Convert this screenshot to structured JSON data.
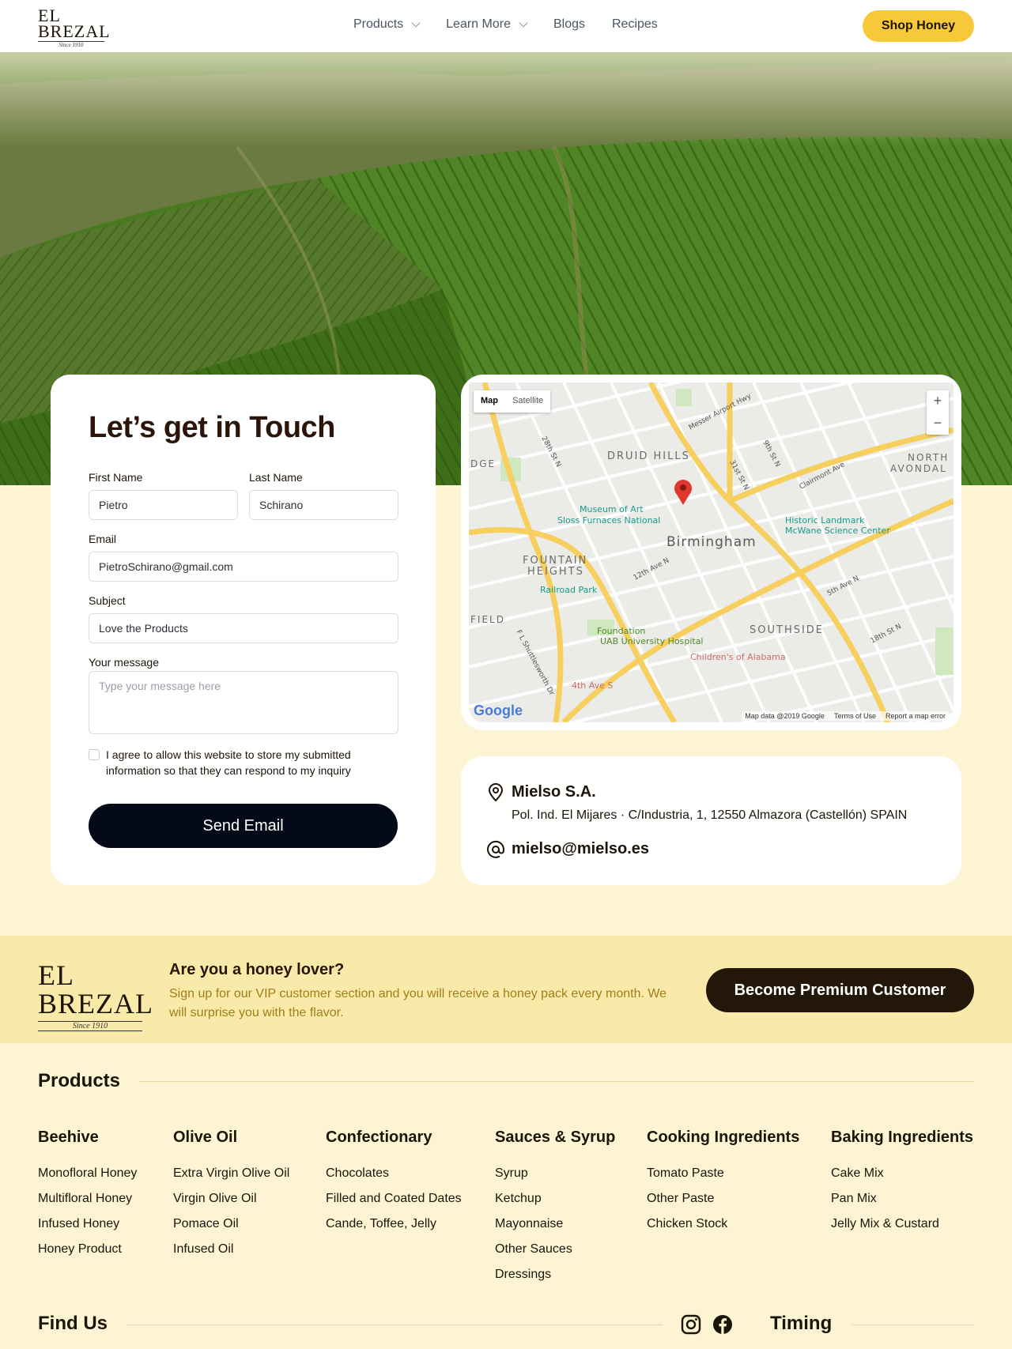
{
  "brand": {
    "logo_top": "EL BREZAL",
    "logo_since": "Since 1910"
  },
  "nav": {
    "items": [
      {
        "label": "Products",
        "dropdown": true
      },
      {
        "label": "Learn More",
        "dropdown": true
      },
      {
        "label": "Blogs",
        "dropdown": false
      },
      {
        "label": "Recipes",
        "dropdown": false
      }
    ],
    "cta": "Shop Honey"
  },
  "contact": {
    "title": "Let’s get in Touch",
    "first_name_label": "First Name",
    "first_name_value": "Pietro",
    "last_name_label": "Last Name",
    "last_name_value": "Schirano",
    "email_label": "Email",
    "email_value": "PietroSchirano@gmail.com",
    "subject_label": "Subject",
    "subject_value": "Love the Products",
    "message_label": "Your message",
    "message_placeholder": "Type your message here",
    "consent": "I agree to allow this website to store my submitted information so that they can respond to my inquiry",
    "submit": "Send Email"
  },
  "map": {
    "toggle": [
      "Map",
      "Satellite"
    ],
    "city": "Birmingham",
    "labels": [
      "DRUID HILLS",
      "FOUNTAIN",
      "HEIGHTS",
      "SOUTHSIDE",
      "NORTH",
      "AVONDAL",
      "DGE",
      "FIELD",
      "Birmingham",
      "Museum of Art",
      "Sloss Furnaces National",
      "Historic Landmark",
      "McWane Science Center",
      "Railroad Park",
      "Foundation",
      "UAB University Hospital",
      "Children's of Alabama",
      "4th Ave S",
      "5th Ave N",
      "12th Ave N",
      "Messer Airport Hwy",
      "Clairmont Ave",
      "18th St N",
      "28th St N",
      "31st St N",
      "9th St N",
      "F L Shuttlesworth Dr"
    ],
    "attribution": [
      "Map data @2019 Google",
      "Terms of Use",
      "Report a map error"
    ],
    "google": "Google"
  },
  "address": {
    "company": "Mielso S.A.",
    "address": "Pol. Ind. El Mijares · C/Industria, 1, 12550 Almazora (Castellón) SPAIN",
    "email": "mielso@mielso.es"
  },
  "banner": {
    "title": "Are you a honey lover?",
    "text": "Sign up for our VIP customer section and you will receive a honey pack every month. We will surprise you with the flavor.",
    "cta": "Become Premium Customer"
  },
  "footer": {
    "products_title": "Products",
    "categories": [
      {
        "title": "Beehive",
        "items": [
          "Monofloral Honey",
          "Multifloral Honey",
          "Infused Honey",
          "Honey Product"
        ]
      },
      {
        "title": "Olive Oil",
        "items": [
          "Extra Virgin Olive Oil",
          "Virgin Olive Oil",
          "Pomace Oil",
          "Infused Oil"
        ]
      },
      {
        "title": "Confectionary",
        "items": [
          "Chocolates",
          "Filled and Coated Dates",
          "Cande, Toffee, Jelly"
        ]
      },
      {
        "title": "Sauces & Syrup",
        "items": [
          "Syrup",
          "Ketchup",
          "Mayonnaise",
          "Other Sauces",
          "Dressings"
        ]
      },
      {
        "title": "Cooking Ingredients",
        "items": [
          "Tomato Paste",
          "Other Paste",
          "Chicken Stock"
        ]
      },
      {
        "title": "Baking Ingredients",
        "items": [
          "Cake Mix",
          "Pan Mix",
          "Jelly Mix & Custard"
        ]
      }
    ],
    "find_us": "Find Us",
    "timing": "Timing"
  },
  "colors": {
    "accent": "#f7c93a",
    "dark": "#050a18",
    "cream": "#fdf4d4",
    "banner": "#faeaa9",
    "banner_text": "#a07e18"
  }
}
